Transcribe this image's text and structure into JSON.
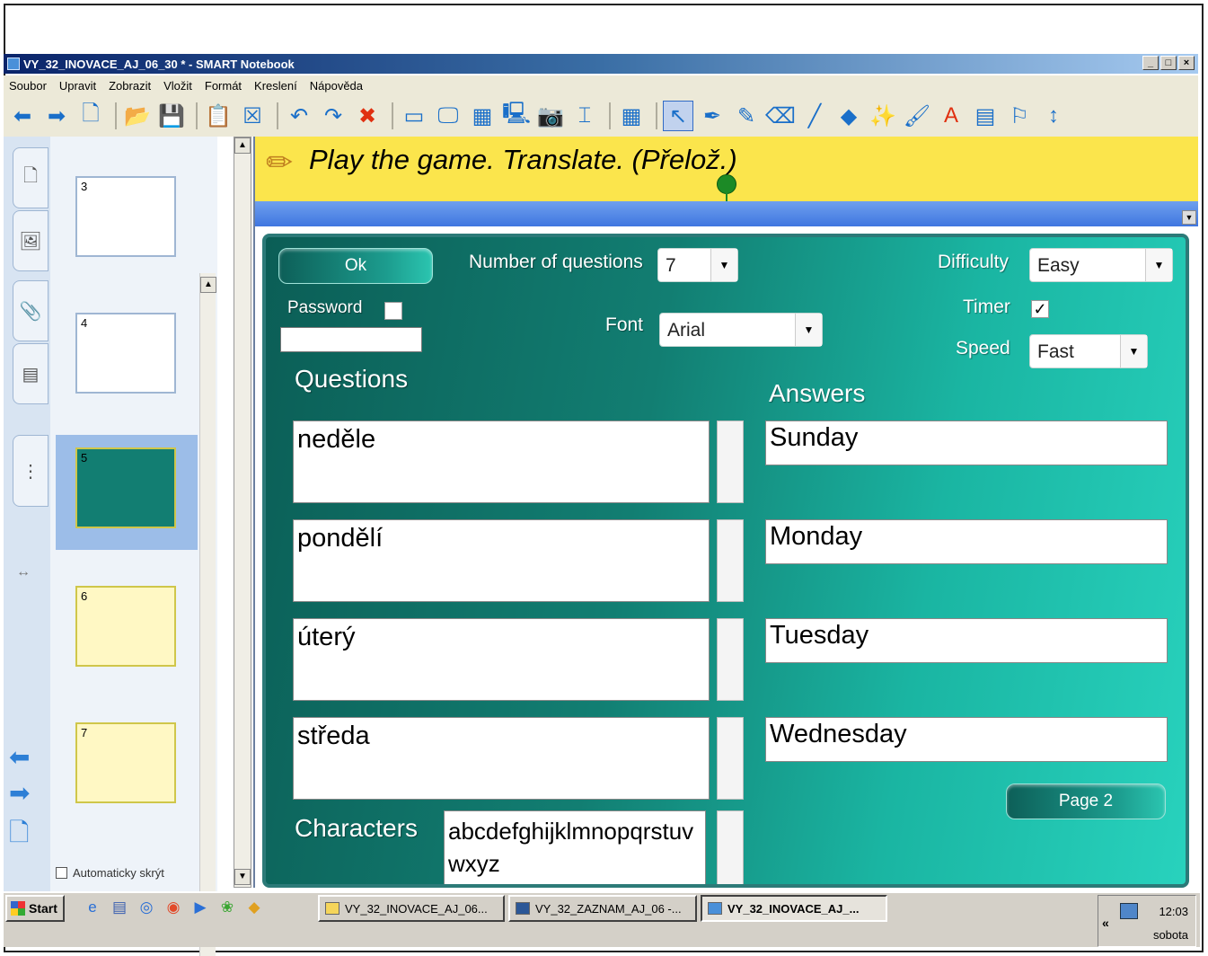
{
  "window": {
    "title": "VY_32_INOVACE_AJ_06_30 * - SMART Notebook",
    "controls": [
      "_",
      "□",
      "×"
    ]
  },
  "menu": [
    "Soubor",
    "Upravit",
    "Zobrazit",
    "Vložit",
    "Formát",
    "Kreslení",
    "Nápověda"
  ],
  "sorter": {
    "thumbnails": [
      "3",
      "4",
      "5",
      "6",
      "7"
    ],
    "autohide_label": "Automaticky skrýt"
  },
  "page": {
    "title": "Play the game. Translate. (Přelož.)"
  },
  "game": {
    "ok_label": "Ok",
    "num_questions_label": "Number of questions",
    "num_questions_value": "7",
    "difficulty_label": "Difficulty",
    "difficulty_value": "Easy",
    "password_label": "Password",
    "font_label": "Font",
    "font_value": "Arial",
    "timer_label": "Timer",
    "timer_mark": "✓",
    "speed_label": "Speed",
    "speed_value": "Fast",
    "questions_heading": "Questions",
    "answers_heading": "Answers",
    "questions": [
      "neděle",
      "pondělí",
      "úterý",
      "středa"
    ],
    "answers": [
      "Sunday",
      "Monday",
      "Tuesday",
      "Wednesday"
    ],
    "characters_label": "Characters",
    "characters_value": "abcdefghijklmnopqrstuvwxyz",
    "page2_label": "Page 2"
  },
  "taskbar": {
    "start_label": "Start",
    "tasks": [
      "VY_32_INOVACE_AJ_06...",
      "VY_32_ZAZNAM_AJ_06 -...",
      "VY_32_INOVACE_AJ_..."
    ],
    "time": "12:03",
    "day": "sobota",
    "tray_chevron": "«"
  }
}
